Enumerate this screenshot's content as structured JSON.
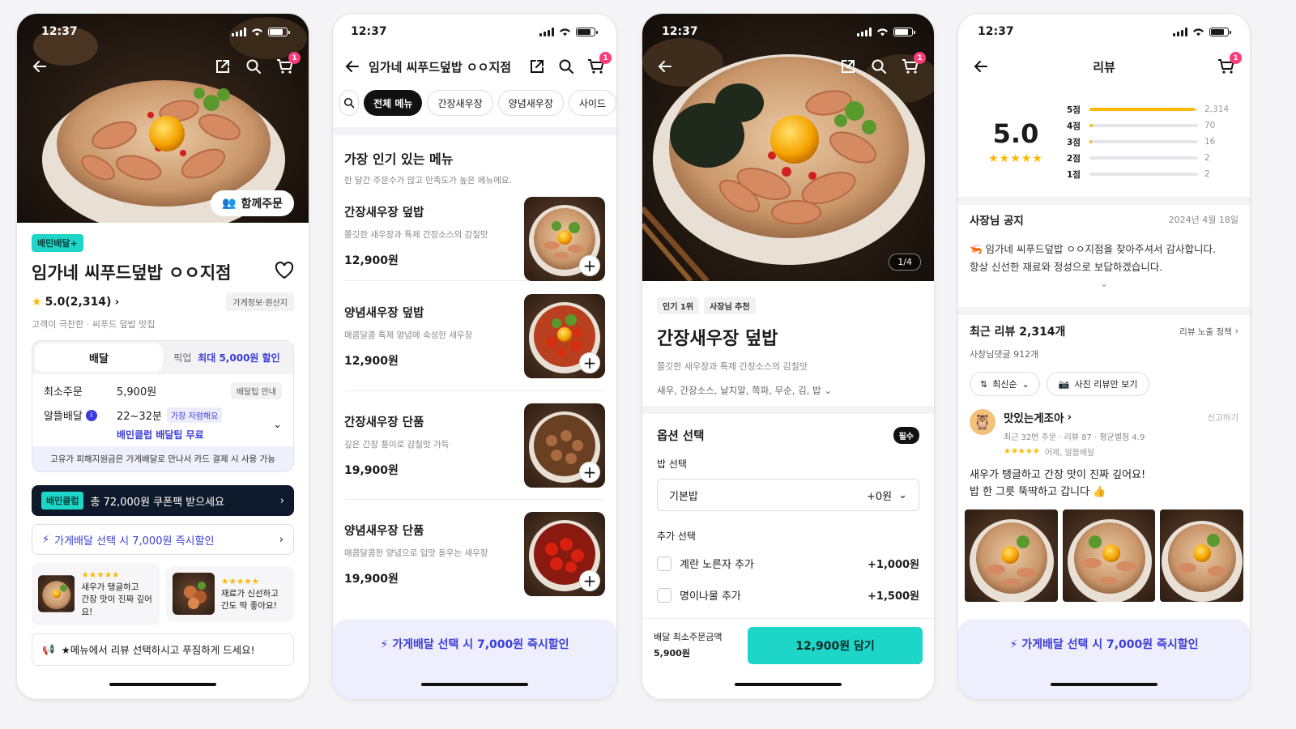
{
  "status": {
    "time": "12:37"
  },
  "cart_badge": "1",
  "screen1": {
    "group_order": "함께주문",
    "badge": "배민배달+",
    "store_name": "임가네 씨푸드덮밥 ㅇㅇ지점",
    "rating": "5.0(2,314)",
    "store_info": "가게정보·원산지",
    "tagline": "고객이 극찬한 · 씨푸드 덮밥 맛집",
    "tab_delivery": "배달",
    "tab_pickup": "픽업",
    "tab_pickup_discount": "최대 5,000원 할인",
    "min_order_label": "최소주문",
    "min_order_value": "5,900원",
    "delivery_tip_guide": "배달팁 안내",
    "alddle_label": "알뜰배달",
    "delivery_time": "22~32분",
    "cheapest": "가장 저렴해요",
    "club_free": "배민클럽 배달팁 무료",
    "notice": "고유가 피해지원금은 가게배달로 만나서 카드 결제 시 사용 가능",
    "club_chip": "배민클럽",
    "coupon_text": "총 72,000원 쿠폰팩 받으세요",
    "store_delivery_discount": "가게배달 선택 시 7,000원 즉시할인",
    "review_cards": [
      {
        "stars": "★★★★★",
        "line1": "새우가 탱글하고",
        "line2": "간장 맛이 진짜 깊어요!"
      },
      {
        "stars": "★★★★★",
        "line1": "재료가 신선하고",
        "line2": "간도 딱 좋아요!"
      }
    ],
    "review_event": "★메뉴에서 리뷰 선택하시고 푸짐하게 드세요!"
  },
  "screen2": {
    "title": "임가네 씨푸드덮밥 ㅇㅇ지점",
    "tabs": [
      "전체 메뉴",
      "간장새우장",
      "양념새우장",
      "사이드"
    ],
    "section_title": "가장 인기 있는 메뉴",
    "section_sub": "한 달간 주문수가 많고 만족도가 높은 메뉴에요.",
    "items": [
      {
        "name": "간장새우장 덮밥",
        "desc": "쫄깃한 새우장과 특제 간장소스의 감칠맛",
        "price": "12,900원"
      },
      {
        "name": "양념새우장 덮밥",
        "desc": "매콤달콤 특제 양념에 숙성한 새우장",
        "price": "12,900원"
      },
      {
        "name": "간장새우장 단품",
        "desc": "깊은 간장 풍미로 감칠맛 가득",
        "price": "19,900원"
      },
      {
        "name": "양념새우장 단품",
        "desc": "매콤달콤한 양념으로 입맛 돋우는 새우장",
        "price": "19,900원"
      }
    ],
    "banner": "가게배달 선택 시 7,000원 즉시할인"
  },
  "screen3": {
    "page_indicator": "1/4",
    "chip_popular": "인기 1위",
    "chip_owner": "사장님 추천",
    "item_name": "간장새우장 덮밥",
    "item_desc": "쫄깃한 새우장과 특제 간장소스의 감칠맛",
    "ingredients": "새우, 간장소스, 날치알, 쪽파, 무순, 김, 밥",
    "option_title": "옵션 선택",
    "required": "필수",
    "rice_label": "밥 선택",
    "rice_value": "기본밥",
    "rice_price": "+0원",
    "extra_label": "추가 선택",
    "extras": [
      {
        "name": "계란 노른자 추가",
        "price": "+1,000원"
      },
      {
        "name": "명이나물 추가",
        "price": "+1,500원"
      }
    ],
    "min_order_label": "배달 최소주문금액",
    "min_order_value": "5,900원",
    "add_button": "12,900원 담기"
  },
  "screen4": {
    "title": "리뷰",
    "score": "5.0",
    "stars": "★★★★★",
    "distribution": [
      {
        "label": "5점",
        "count": "2,314",
        "fraction": 0.97
      },
      {
        "label": "4점",
        "count": "70",
        "fraction": 0.03
      },
      {
        "label": "3점",
        "count": "16",
        "fraction": 0.01
      },
      {
        "label": "2점",
        "count": "2",
        "fraction": 0.0
      },
      {
        "label": "1점",
        "count": "2",
        "fraction": 0.0
      }
    ],
    "notice_title": "사장님 공지",
    "notice_date": "2024년 4월 18일",
    "notice_line1": "임가네 씨푸드덮밥 ㅇㅇ지점을 찾아주셔서 감사합니다.",
    "notice_line2": "항상 신선한 재료와 정성으로 보답하겠습니다.",
    "recent_reviews": "최근 리뷰 2,314개",
    "review_policy": "리뷰 노출 정책",
    "owner_replies": "사장님댓글 912개",
    "sort": "최신순",
    "photo_only": "사진 리뷰만 보기",
    "reviewer": "맛있는게조아",
    "report": "신고하기",
    "reviewer_meta": "최근 32번 주문 · 리뷰 87 · 평균별점 4.9",
    "review_stars": "★★★★★",
    "review_date": "어제, 알뜰배달",
    "review_line1": "새우가 탱글하고 간장 맛이 진짜 깊어요!",
    "review_line2": "밥 한 그릇 뚝딱하고 갑니다 👍",
    "banner": "가게배달 선택 시 7,000원 즉시할인"
  },
  "colors": {
    "brand_mint": "#1ed6c8",
    "indigo": "#3b3dd8",
    "star": "#ffb800",
    "navy": "#0e1a2b",
    "badge_pink": "#ff3b7a"
  }
}
